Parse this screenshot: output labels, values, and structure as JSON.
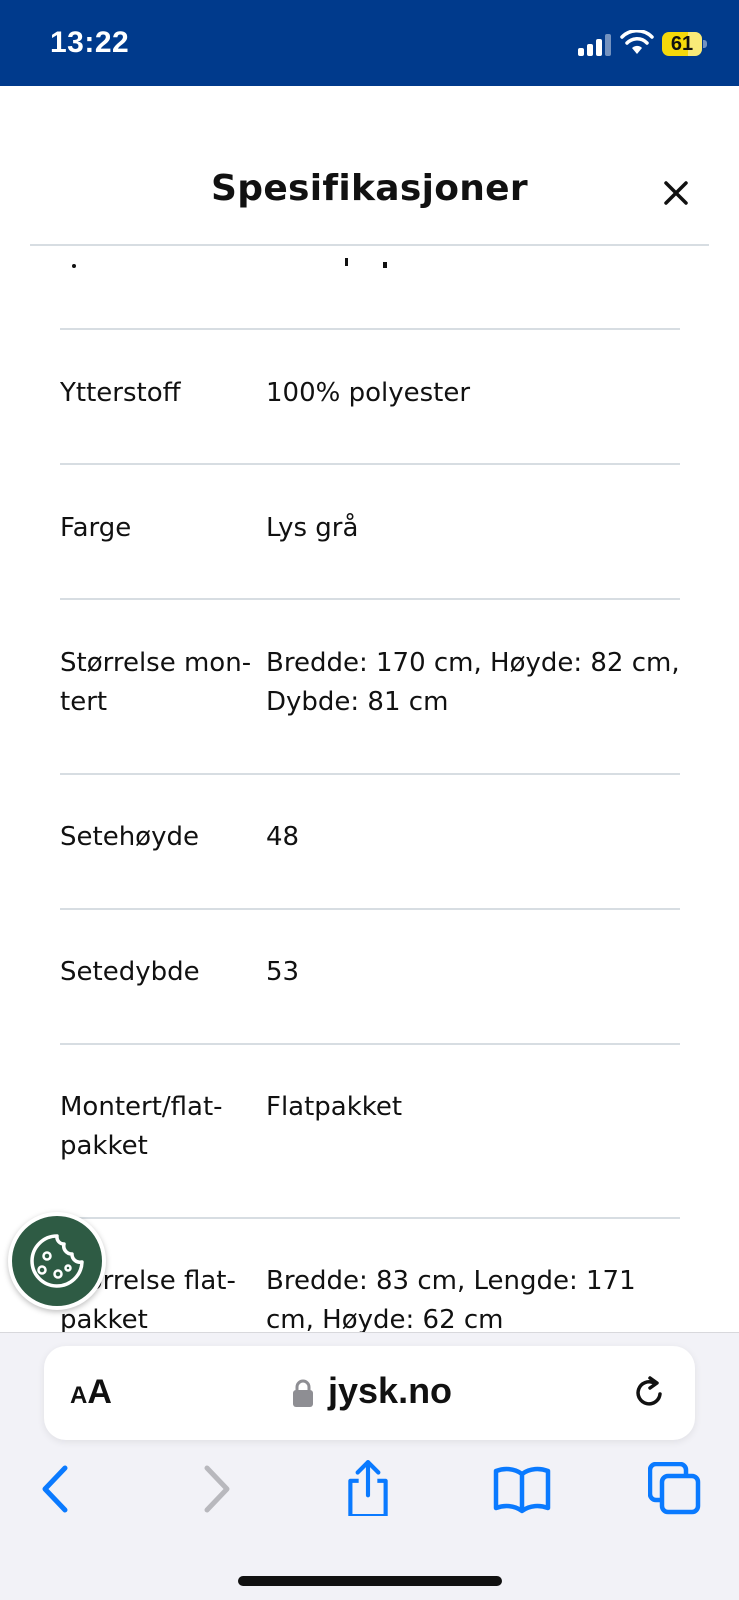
{
  "status_bar": {
    "time": "13:22",
    "battery": "61",
    "background_color": "#003a8c",
    "battery_color": "#f5d90a"
  },
  "modal": {
    "title": "Spesifikasjoner",
    "close_icon": "close-icon"
  },
  "specs": {
    "rows": [
      {
        "label": "Ytterstoff",
        "value": "100% polyester"
      },
      {
        "label": "Farge",
        "value": "Lys grå"
      },
      {
        "label": "Størrelse mon-\ntert",
        "value": "Bredde: 170 cm, Høyde: 82 cm, Dybde: 81 cm"
      },
      {
        "label": "Setehøyde",
        "value": "48"
      },
      {
        "label": "Setedybde",
        "value": "53"
      },
      {
        "label": "Montert/flat-\npakket",
        "value": "Flatpakket"
      },
      {
        "label": "Størrelse flat-\npakket",
        "value": "Bredde: 83 cm, Lengde: 171 cm, Høyde: 62 cm"
      }
    ]
  },
  "cookie_button": {
    "icon": "cookie-icon",
    "color": "#2e5b44"
  },
  "browser": {
    "aa_small": "A",
    "aa_big": "A",
    "url": "jysk.no",
    "icons": [
      "lock-icon",
      "reload-icon",
      "back-icon",
      "forward-icon",
      "share-icon",
      "bookmarks-icon",
      "tabs-icon"
    ],
    "accent_color": "#0a7aff"
  }
}
